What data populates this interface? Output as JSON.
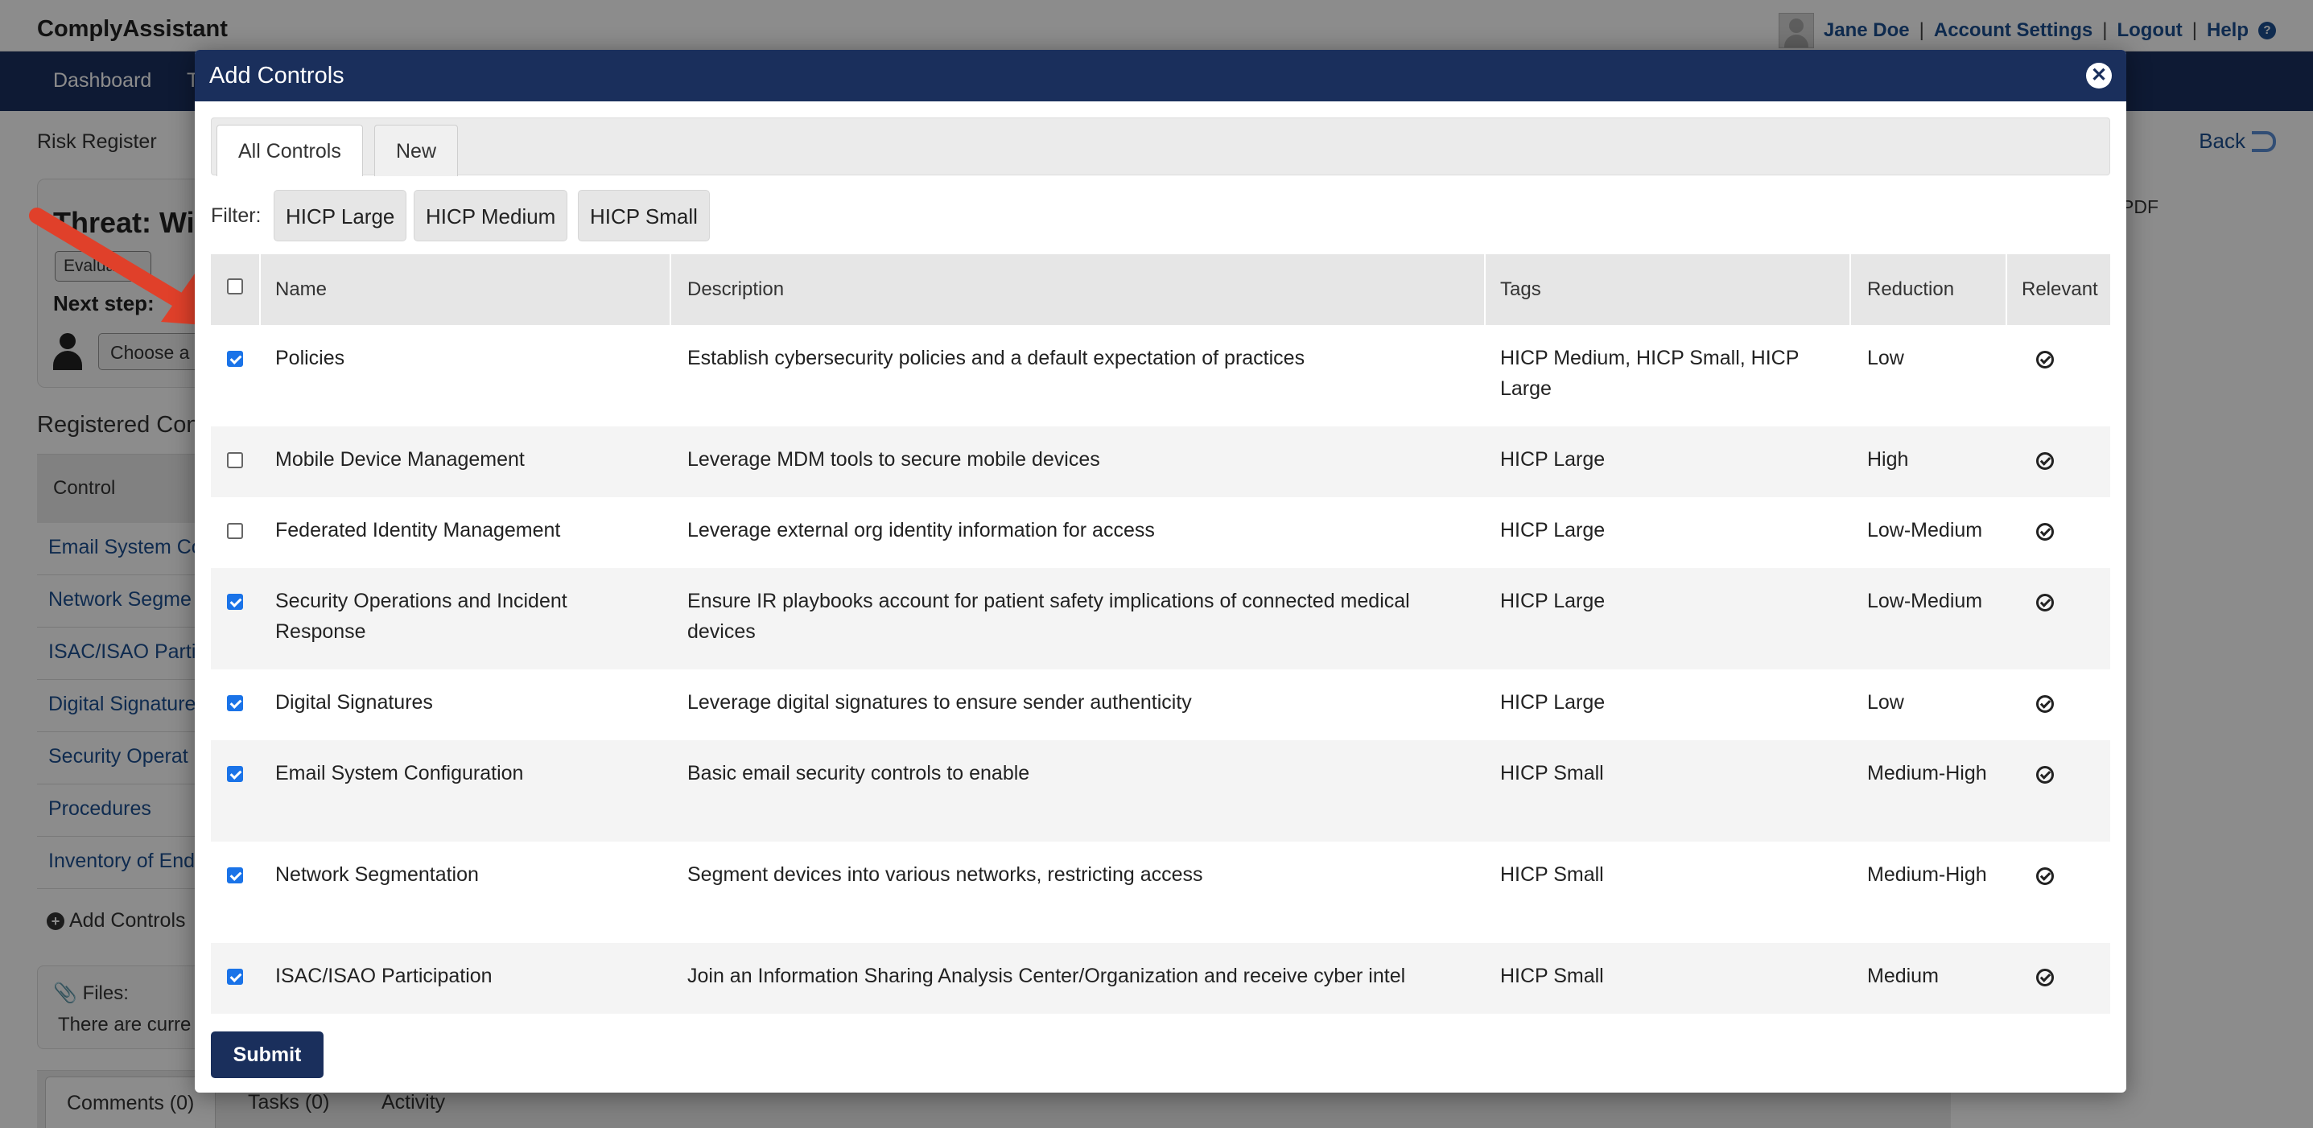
{
  "app": {
    "title": "ComplyAssistant",
    "user_name": "Jane Doe",
    "account_settings": "Account Settings",
    "logout": "Logout",
    "help": "Help",
    "separator": "|"
  },
  "nav": {
    "dashboard": "Dashboard",
    "truncated": "T"
  },
  "page": {
    "breadcrumb": "Risk Register",
    "back": "Back",
    "pdf": "PDF",
    "threat_title": "Threat: Wir",
    "evaluate": "Evaluate",
    "next_step": "Next step:",
    "choose": "Choose a",
    "registered_title": "Registered Con",
    "control_header": "Control",
    "registered_items": [
      "Email System Co",
      "Network Segme",
      "ISAC/ISAO Parti",
      "Digital Signature",
      "Security Operat",
      "Procedures",
      "Inventory of End"
    ],
    "add_controls": "Add Controls",
    "files_label": "Files:",
    "files_text": "There are curre",
    "bottom_tabs": [
      "Comments (0)",
      "Tasks (0)",
      "Activity"
    ]
  },
  "modal": {
    "title": "Add Controls",
    "tabs": [
      "All Controls",
      "New"
    ],
    "filter_label": "Filter:",
    "filters": [
      "HICP Large",
      "HICP Medium",
      "HICP Small"
    ],
    "columns": [
      "Name",
      "Description",
      "Tags",
      "Reduction",
      "Relevant"
    ],
    "rows": [
      {
        "checked": true,
        "name": "Policies",
        "description": "Establish cybersecurity policies and a default expectation of practices",
        "tags": "HICP Medium, HICP Small, HICP Large",
        "reduction": "Low"
      },
      {
        "checked": false,
        "name": "Mobile Device Management",
        "description": "Leverage MDM tools to secure mobile devices",
        "tags": "HICP Large",
        "reduction": "High"
      },
      {
        "checked": false,
        "name": "Federated Identity Management",
        "description": "Leverage external org identity information for access",
        "tags": "HICP Large",
        "reduction": "Low-Medium"
      },
      {
        "checked": true,
        "name": "Security Operations and Incident Response",
        "description": "Ensure IR playbooks account for patient safety implications of connected medical devices",
        "tags": "HICP Large",
        "reduction": "Low-Medium"
      },
      {
        "checked": true,
        "name": "Digital Signatures",
        "description": "Leverage digital signatures to ensure sender authenticity",
        "tags": "HICP Large",
        "reduction": "Low"
      },
      {
        "checked": true,
        "name": "Email System Configuration",
        "description": "Basic email security controls to enable",
        "tags": "HICP Small",
        "reduction": "Medium-High"
      },
      {
        "checked": true,
        "name": "Network Segmentation",
        "description": "Segment devices into various networks, restricting access",
        "tags": "HICP Small",
        "reduction": "Medium-High"
      },
      {
        "checked": true,
        "name": "ISAC/ISAO Participation",
        "description": "Join an Information Sharing Analysis Center/Organization and receive cyber intel",
        "tags": "HICP Small",
        "reduction": "Medium"
      }
    ],
    "submit": "Submit"
  },
  "colors": {
    "nav": "#1a3160",
    "modal_header": "#1a2f5c",
    "link": "#1d4f91",
    "checkbox": "#1a73e8",
    "arrow": "#e0402a"
  }
}
